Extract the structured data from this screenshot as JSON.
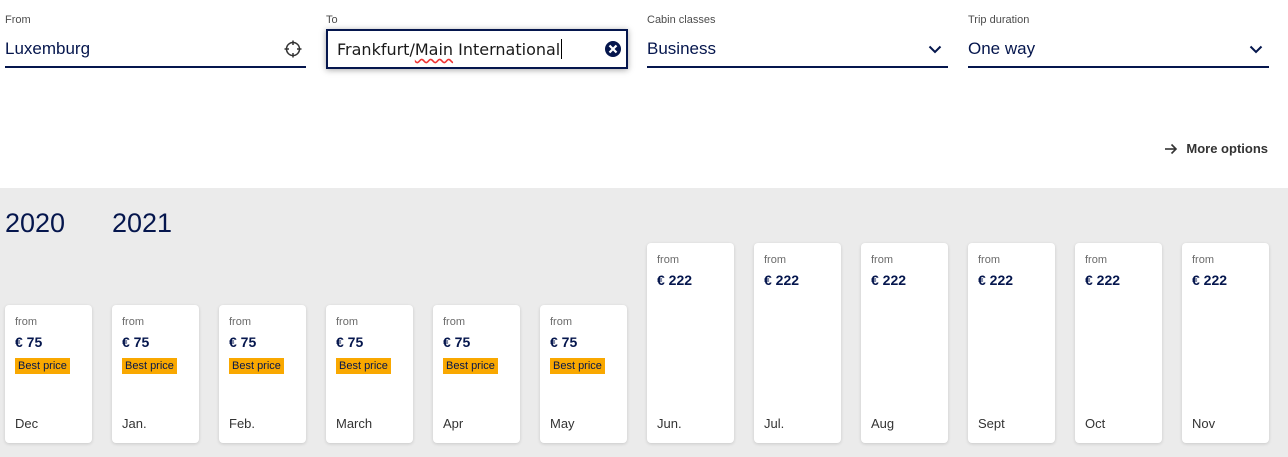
{
  "search": {
    "from": {
      "label": "From",
      "value": "Luxemburg",
      "icon": "crosshair-icon"
    },
    "to": {
      "label": "To",
      "value_part1": "Frankfurt/",
      "value_spell": "Main",
      "value_part2": " International",
      "icon": "clear-icon"
    },
    "cabin": {
      "label": "Cabin classes",
      "value": "Business",
      "icon": "chevron-down-icon"
    },
    "trip": {
      "label": "Trip duration",
      "value": "One way",
      "icon": "chevron-down-icon"
    }
  },
  "more_options": "More options",
  "years": [
    "2020",
    "2021"
  ],
  "months": [
    {
      "from": "from",
      "price": "€ 75",
      "badge": "Best price",
      "month": "Dec"
    },
    {
      "from": "from",
      "price": "€ 75",
      "badge": "Best price",
      "month": "Jan."
    },
    {
      "from": "from",
      "price": "€ 75",
      "badge": "Best price",
      "month": "Feb."
    },
    {
      "from": "from",
      "price": "€ 75",
      "badge": "Best price",
      "month": "March"
    },
    {
      "from": "from",
      "price": "€ 75",
      "badge": "Best price",
      "month": "Apr"
    },
    {
      "from": "from",
      "price": "€ 75",
      "badge": "Best price",
      "month": "May"
    },
    {
      "from": "from",
      "price": "€ 222",
      "badge": "",
      "month": "Jun."
    },
    {
      "from": "from",
      "price": "€ 222",
      "badge": "",
      "month": "Jul."
    },
    {
      "from": "from",
      "price": "€ 222",
      "badge": "",
      "month": "Aug"
    },
    {
      "from": "from",
      "price": "€ 222",
      "badge": "",
      "month": "Sept"
    },
    {
      "from": "from",
      "price": "€ 222",
      "badge": "",
      "month": "Oct"
    },
    {
      "from": "from",
      "price": "€ 222",
      "badge": "",
      "month": "Nov"
    }
  ],
  "colors": {
    "brand": "#05164d",
    "best_price": "#f9a800",
    "band": "#ebebeb"
  }
}
